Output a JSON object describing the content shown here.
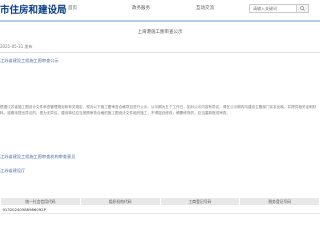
{
  "header": {
    "site_title": "市住房和建设局",
    "nav": [
      "首页",
      "政务服务",
      "互动交流"
    ],
    "search_placeholder": "请输入关键词"
  },
  "document": {
    "heading": "上海港施工图审查公示",
    "date_line": "2021-05-31 发布",
    "project_label": "江苏省建设工程施工图审查公示",
    "body_text": "根据江苏省施工图设计文件审查管理规定和有关规定，现对以下施工图审查合格项目进行公示。公示期为五个工作日，如对公示内容有异议，请在公示期内向建设主管部门实名反映，并提供相关证明材料。逾期未提出异议的，视为无异议。建设单位应当按照审查合格的施工图设计文件组织施工，不得擅自修改；确需修改的，应当重新报送审查。",
    "review_label": "江苏省建设工程施工图审查机构审查意见",
    "org_label": "江苏省建设厅",
    "table": {
      "headers": [
        "统一社会信用代码",
        "组织机构代码",
        "工商登记号码",
        "税务登记号码"
      ],
      "rows": [
        [
          "91320240588986092P",
          "",
          "",
          ""
        ]
      ]
    }
  }
}
